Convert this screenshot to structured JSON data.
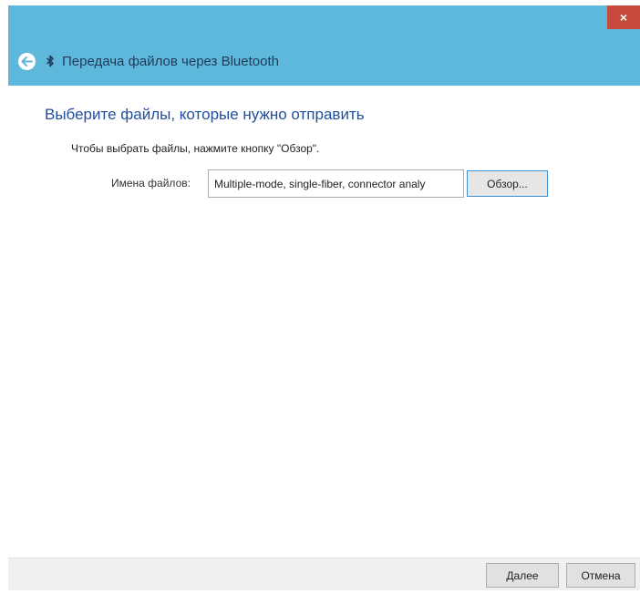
{
  "window": {
    "title": "Передача файлов через Bluetooth",
    "close_label": "×",
    "colors": {
      "frame": "#5eb8dc",
      "close": "#c74b3d",
      "heading": "#1f4f9c"
    }
  },
  "icons": {
    "back": "back-arrow-icon",
    "bluetooth": "bluetooth-icon"
  },
  "main": {
    "heading": "Выберите файлы, которые нужно отправить",
    "instruction": "Чтобы выбрать файлы, нажмите кнопку \"Обзор\".",
    "field_label": "Имена файлов:",
    "file_value": "Multiple-mode, single-fiber, connector analy",
    "browse_label": "Обзор..."
  },
  "footer": {
    "next_label": "Далее",
    "cancel_label": "Отмена"
  }
}
